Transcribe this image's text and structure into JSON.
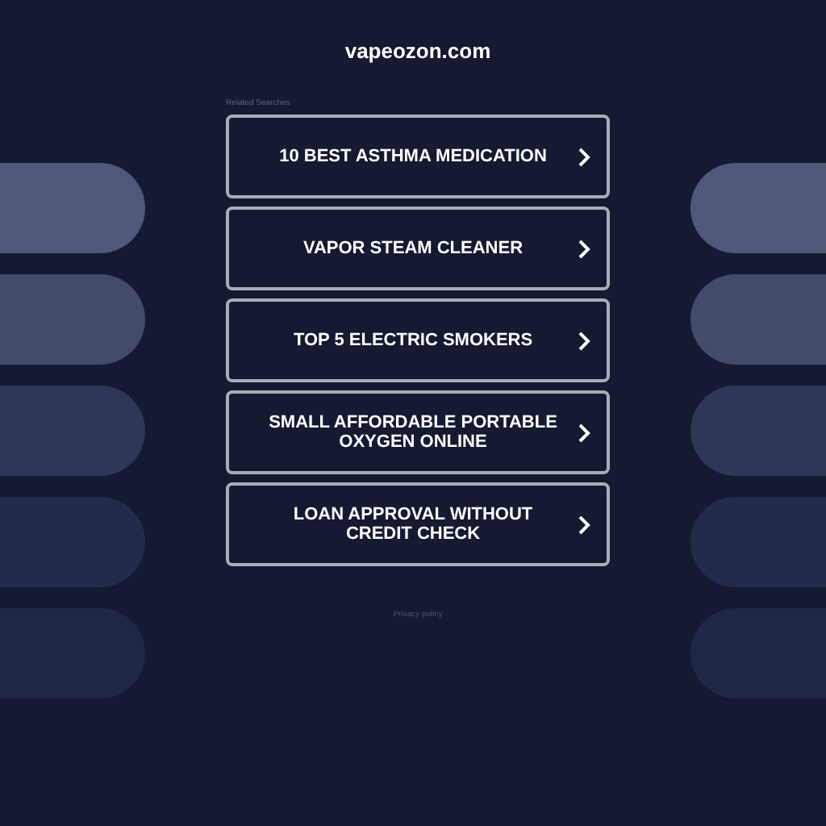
{
  "site_title": "vapeozon.com",
  "related_heading": "Related Searches",
  "links": [
    {
      "label": "10 BEST ASTHMA MEDICATION"
    },
    {
      "label": "VAPOR STEAM CLEANER"
    },
    {
      "label": "TOP 5 ELECTRIC SMOKERS"
    },
    {
      "label": "SMALL AFFORDABLE PORTABLE OXYGEN ONLINE"
    },
    {
      "label": "LOAN APPROVAL WITHOUT CREDIT CHECK"
    }
  ],
  "footer_link": "Privacy policy"
}
